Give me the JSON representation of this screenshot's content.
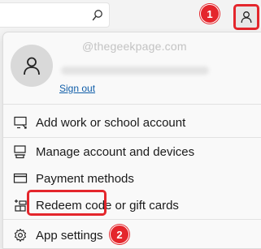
{
  "header": {
    "callout_1": "1",
    "account_icon": "person-icon",
    "search_icon": "search-icon"
  },
  "flyout": {
    "watermark": "@thegeekpage.com",
    "sign_out": "Sign out",
    "menu": [
      {
        "label": "Add work or school account",
        "icon": "add-account-icon"
      },
      {
        "label": "Manage account and devices",
        "icon": "devices-icon"
      },
      {
        "label": "Payment methods",
        "icon": "credit-card-icon"
      },
      {
        "label": "Redeem code or gift cards",
        "icon": "gift-icon"
      },
      {
        "label": "App settings",
        "icon": "gear-icon"
      }
    ],
    "callout_2": "2"
  },
  "colors": {
    "accent_red": "#e4262c",
    "link_blue": "#0f5da8"
  }
}
